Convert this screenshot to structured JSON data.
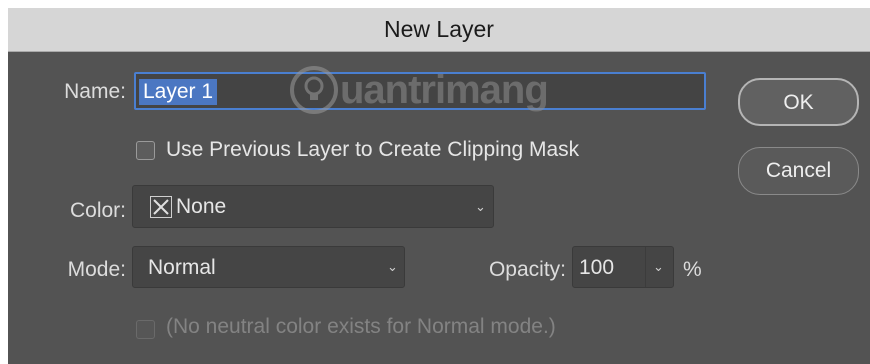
{
  "dialog": {
    "title": "New Layer"
  },
  "name": {
    "label": "Name:",
    "value": "Layer 1"
  },
  "watermark": {
    "text": "uantrimang"
  },
  "clipping": {
    "label": "Use Previous Layer to Create Clipping Mask",
    "checked": false
  },
  "color": {
    "label": "Color:",
    "value": "None",
    "swatch_icon": "x-box-icon"
  },
  "mode": {
    "label": "Mode:",
    "value": "Normal"
  },
  "opacity": {
    "label": "Opacity:",
    "value": "100",
    "unit": "%"
  },
  "neutral": {
    "label": "(No neutral color exists for Normal mode.)",
    "enabled": false
  },
  "buttons": {
    "ok": "OK",
    "cancel": "Cancel"
  },
  "colors": {
    "panel": "#535353",
    "titlebar": "#d6d6d6",
    "selection": "#4b77c2",
    "focus": "#4a7fd1"
  }
}
